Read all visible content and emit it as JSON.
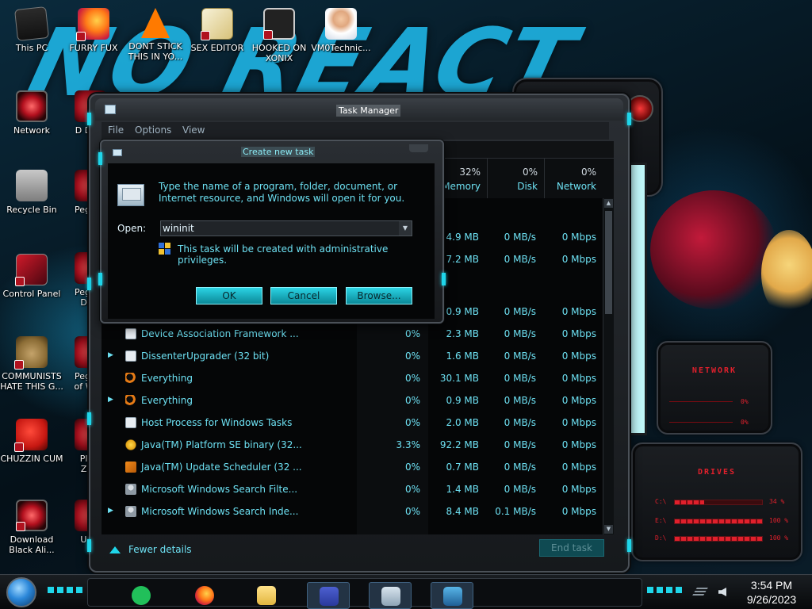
{
  "desktop": {
    "wallpaper_text": "NO REACT",
    "icons": [
      {
        "label": "This PC"
      },
      {
        "label": "FURRY FUX"
      },
      {
        "label": "DONT STICK THIS IN YO..."
      },
      {
        "label": "SEX EDITOR"
      },
      {
        "label": "HOOKED ON XONIX"
      },
      {
        "label": "VM0Technic..."
      },
      {
        "label": "Network"
      },
      {
        "label": "Recycle Bin"
      },
      {
        "label": "Control Panel"
      },
      {
        "label": "COMMUNISTS HATE THIS G..."
      },
      {
        "label": "CHUZZIN CUM"
      },
      {
        "label": "Download Black Ali..."
      }
    ],
    "partial_icons": [
      {
        "label": "D DU"
      },
      {
        "label": "Peggl"
      },
      {
        "label": "Peggl De"
      },
      {
        "label": "Peggl of Wa"
      },
      {
        "label": "Pla Zo"
      },
      {
        "label": "UK"
      }
    ]
  },
  "gadgets": {
    "network": {
      "title": "NETWORK",
      "bars": [
        {
          "label": "0%",
          "fill": 0.0
        },
        {
          "label": "0%",
          "fill": 0.0
        }
      ]
    },
    "drives": {
      "title": "DRIVES",
      "rows": [
        {
          "letter": "C:\\",
          "label": "34 %",
          "fill": 0.34
        },
        {
          "letter": "E:\\",
          "label": "100 %",
          "fill": 1.0
        },
        {
          "letter": "D:\\",
          "label": "100 %",
          "fill": 1.0
        }
      ]
    }
  },
  "task_manager": {
    "title": "Task Manager",
    "menu": [
      "File",
      "Options",
      "View"
    ],
    "columns": {
      "memory": {
        "pct": "32%",
        "name": "Memory"
      },
      "disk": {
        "pct": "0%",
        "name": "Disk"
      },
      "network": {
        "pct": "0%",
        "name": "Network"
      }
    },
    "partial_rows": [
      {
        "mem": "4.9 MB",
        "disk": "0 MB/s",
        "net": "0 Mbps"
      },
      {
        "mem": "7.2 MB",
        "disk": "0 MB/s",
        "net": "0 Mbps"
      },
      {
        "mem": "0.9 MB",
        "disk": "0 MB/s",
        "net": "0 Mbps"
      }
    ],
    "rows": [
      {
        "expand": "",
        "icon": "service-icon",
        "name": "Device Association Framework ...",
        "cpu": "0%",
        "mem": "2.3 MB",
        "disk": "0 MB/s",
        "net": "0 Mbps"
      },
      {
        "expand": "▶",
        "icon": "service-icon",
        "name": "DissenterUpgrader (32 bit)",
        "cpu": "0%",
        "mem": "1.6 MB",
        "disk": "0 MB/s",
        "net": "0 Mbps"
      },
      {
        "expand": "",
        "icon": "search-icon",
        "name": "Everything",
        "cpu": "0%",
        "mem": "30.1 MB",
        "disk": "0 MB/s",
        "net": "0 Mbps"
      },
      {
        "expand": "▶",
        "icon": "search-icon",
        "name": "Everything",
        "cpu": "0%",
        "mem": "0.9 MB",
        "disk": "0 MB/s",
        "net": "0 Mbps"
      },
      {
        "expand": "",
        "icon": "service-icon",
        "name": "Host Process for Windows Tasks",
        "cpu": "0%",
        "mem": "2.0 MB",
        "disk": "0 MB/s",
        "net": "0 Mbps"
      },
      {
        "expand": "",
        "icon": "java-icon",
        "name": "Java(TM) Platform SE binary (32...",
        "cpu": "3.3%",
        "mem": "92.2 MB",
        "disk": "0 MB/s",
        "net": "0 Mbps"
      },
      {
        "expand": "",
        "icon": "java-update-icon",
        "name": "Java(TM) Update Scheduler (32 ...",
        "cpu": "0%",
        "mem": "0.7 MB",
        "disk": "0 MB/s",
        "net": "0 Mbps"
      },
      {
        "expand": "",
        "icon": "user-icon",
        "name": "Microsoft Windows Search Filte...",
        "cpu": "0%",
        "mem": "1.4 MB",
        "disk": "0 MB/s",
        "net": "0 Mbps"
      },
      {
        "expand": "▶",
        "icon": "user-icon",
        "name": "Microsoft Windows Search Inde...",
        "cpu": "0%",
        "mem": "8.4 MB",
        "disk": "0.1 MB/s",
        "net": "0 Mbps"
      }
    ],
    "fewer_details": "Fewer details",
    "end_task": "End task"
  },
  "run_dialog": {
    "title": "Create new task",
    "description": "Type the name of a program, folder, document, or Internet resource, and Windows will open it for you.",
    "open_label": "Open:",
    "open_value": "wininit",
    "admin_note": "This task will be created with administrative privileges.",
    "ok": "OK",
    "cancel": "Cancel",
    "browse": "Browse..."
  },
  "taskbar": {
    "items": [
      {
        "icon": "sticky-notes-icon"
      },
      {
        "icon": "firefox-icon"
      },
      {
        "icon": "file-explorer-icon"
      },
      {
        "icon": "card-app-icon"
      },
      {
        "icon": "task-manager-icon"
      },
      {
        "icon": "run-dialog-icon"
      }
    ],
    "time": "3:54 PM",
    "date": "9/26/2023"
  },
  "theme": {
    "accent": "#1fd6ea",
    "text_cyan": "#6de0f2",
    "gadget_red": "#e0202c"
  }
}
